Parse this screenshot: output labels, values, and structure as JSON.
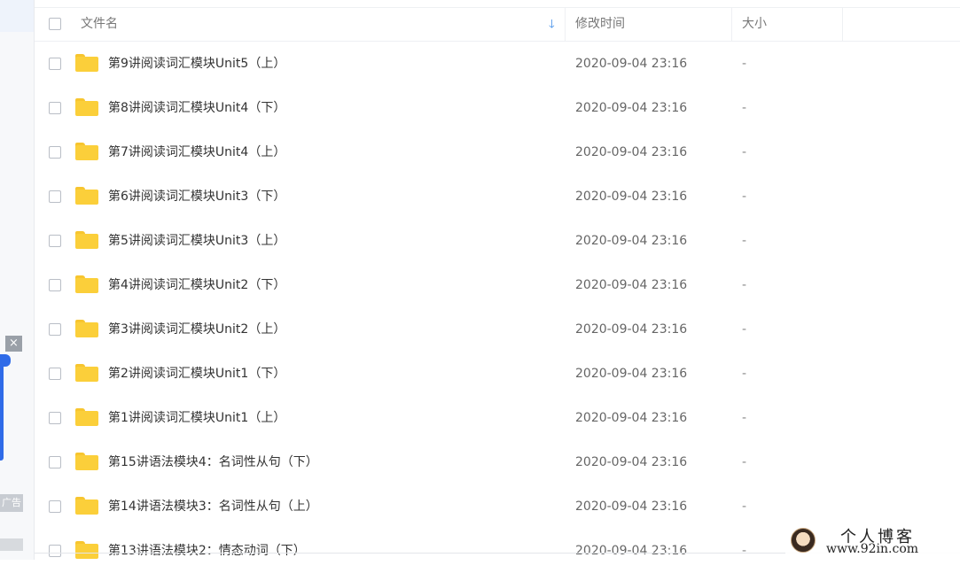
{
  "sidebar": {
    "ad_close_glyph": "×",
    "ad_label": "广告"
  },
  "header": {
    "name": "文件名",
    "sort_icon": "arrow-down-icon",
    "modified": "修改时间",
    "size": "大小"
  },
  "files": [
    {
      "name": "第9讲阅读词汇模块Unit5（上）",
      "modified": "2020-09-04 23:16",
      "size": "-"
    },
    {
      "name": "第8讲阅读词汇模块Unit4（下）",
      "modified": "2020-09-04 23:16",
      "size": "-"
    },
    {
      "name": "第7讲阅读词汇模块Unit4（上）",
      "modified": "2020-09-04 23:16",
      "size": "-"
    },
    {
      "name": "第6讲阅读词汇模块Unit3（下）",
      "modified": "2020-09-04 23:16",
      "size": "-"
    },
    {
      "name": "第5讲阅读词汇模块Unit3（上）",
      "modified": "2020-09-04 23:16",
      "size": "-"
    },
    {
      "name": "第4讲阅读词汇模块Unit2（下）",
      "modified": "2020-09-04 23:16",
      "size": "-"
    },
    {
      "name": "第3讲阅读词汇模块Unit2（上）",
      "modified": "2020-09-04 23:16",
      "size": "-"
    },
    {
      "name": "第2讲阅读词汇模块Unit1（下）",
      "modified": "2020-09-04 23:16",
      "size": "-"
    },
    {
      "name": "第1讲阅读词汇模块Unit1（上）",
      "modified": "2020-09-04 23:16",
      "size": "-"
    },
    {
      "name": "第15讲语法模块4：名词性从句（下）",
      "modified": "2020-09-04 23:16",
      "size": "-"
    },
    {
      "name": "第14讲语法模块3：名词性从句（上）",
      "modified": "2020-09-04 23:16",
      "size": "-"
    },
    {
      "name": "第13讲语法模块2：情态动词（下）",
      "modified": "2020-09-04 23:16",
      "size": "-"
    }
  ],
  "watermark": {
    "title": "个人博客",
    "url": "www.92in.com"
  },
  "colors": {
    "accent": "#3e8ce8",
    "folder": "#fbcf3a",
    "ad_blue": "#2f6be8"
  }
}
